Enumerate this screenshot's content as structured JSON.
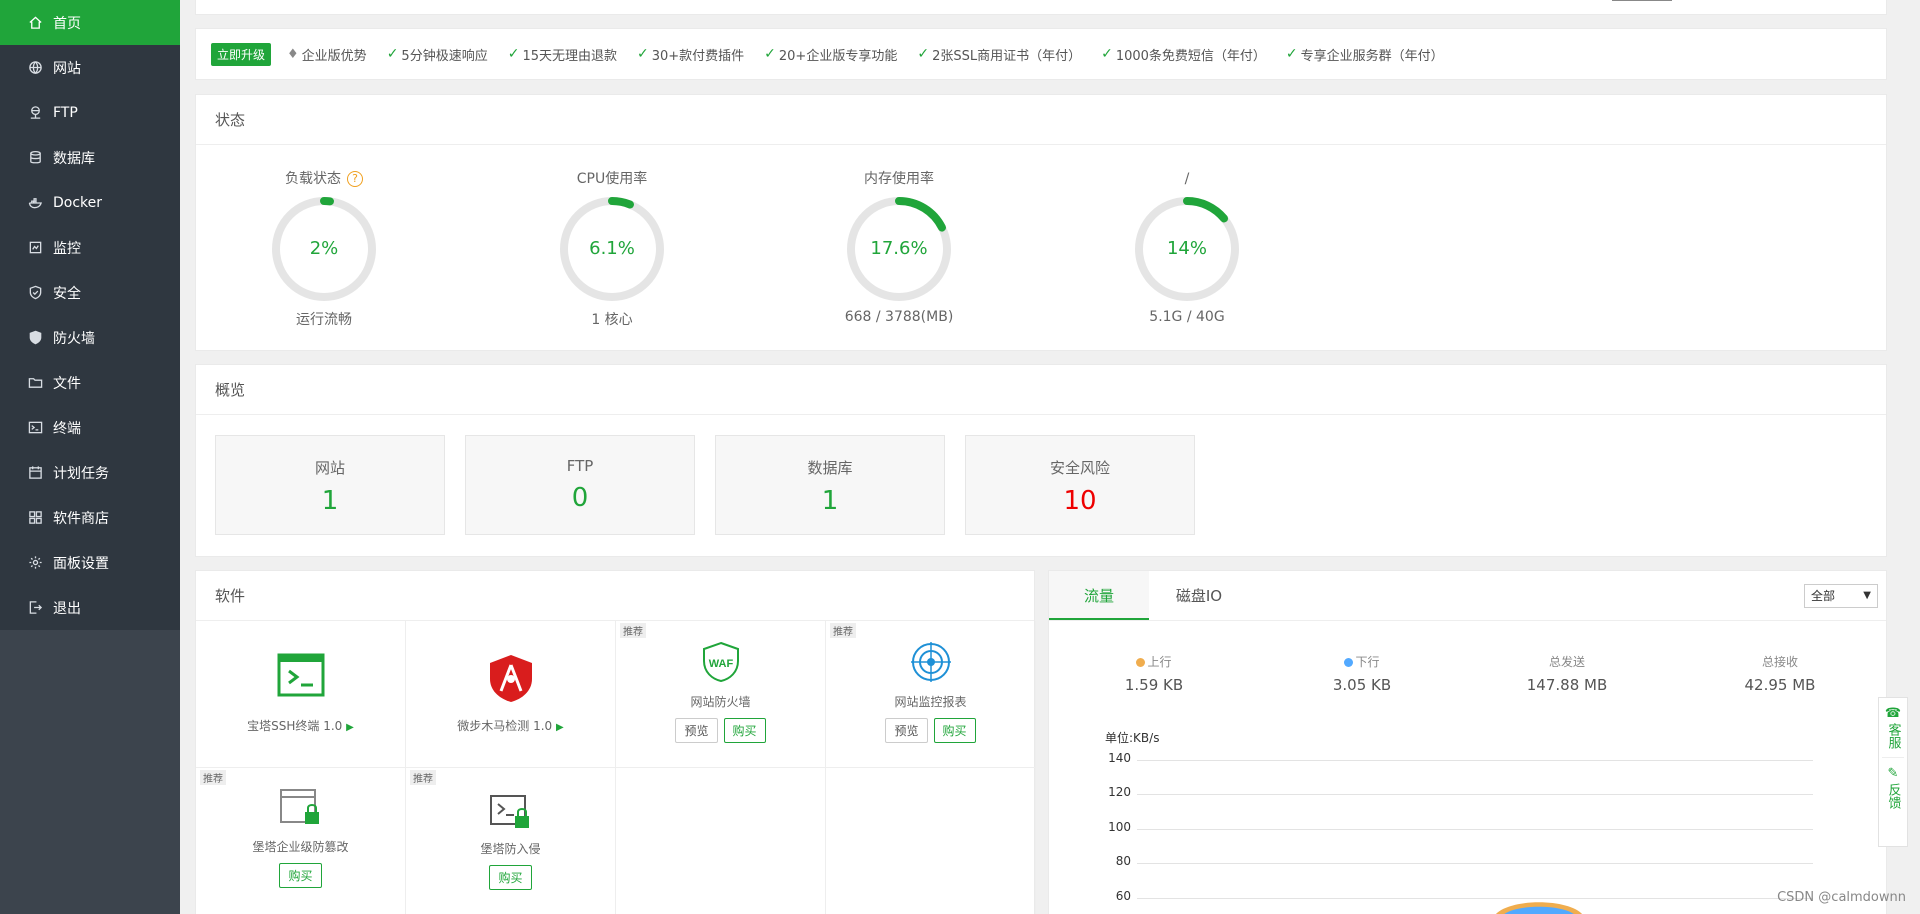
{
  "sidebar": {
    "items": [
      {
        "label": "首页",
        "icon": "home-icon",
        "active": true
      },
      {
        "label": "网站",
        "icon": "globe-icon"
      },
      {
        "label": "FTP",
        "icon": "ftp-icon"
      },
      {
        "label": "数据库",
        "icon": "database-icon"
      },
      {
        "label": "Docker",
        "icon": "docker-icon"
      },
      {
        "label": "监控",
        "icon": "monitor-icon"
      },
      {
        "label": "安全",
        "icon": "shield-icon"
      },
      {
        "label": "防火墙",
        "icon": "firewall-icon"
      },
      {
        "label": "文件",
        "icon": "folder-icon"
      },
      {
        "label": "终端",
        "icon": "terminal-icon"
      },
      {
        "label": "计划任务",
        "icon": "calendar-icon"
      },
      {
        "label": "软件商店",
        "icon": "grid-icon"
      },
      {
        "label": "面板设置",
        "icon": "gear-icon"
      },
      {
        "label": "退出",
        "icon": "logout-icon"
      }
    ]
  },
  "promo": {
    "upgrade": "立即升级",
    "title": "企业版优势",
    "items": [
      "5分钟极速响应",
      "15天无理由退款",
      "30+款付费插件",
      "20+企业版专享功能",
      "2张SSL商用证书（年付）",
      "1000条免费短信（年付）",
      "专享企业服务群（年付）"
    ]
  },
  "status": {
    "title": "状态",
    "gauges": [
      {
        "label": "负载状态",
        "value": "2%",
        "fraction": 0.02,
        "sub": "运行流畅",
        "help": "?"
      },
      {
        "label": "CPU使用率",
        "value": "6.1%",
        "fraction": 0.061,
        "sub": "1 核心"
      },
      {
        "label": "内存使用率",
        "value": "17.6%",
        "fraction": 0.176,
        "sub": "668 / 3788(MB)"
      },
      {
        "label": "/",
        "value": "14%",
        "fraction": 0.14,
        "sub": "5.1G / 40G"
      }
    ]
  },
  "overview": {
    "title": "概览",
    "boxes": [
      {
        "label": "网站",
        "value": "1"
      },
      {
        "label": "FTP",
        "value": "0"
      },
      {
        "label": "数据库",
        "value": "1"
      },
      {
        "label": "安全风险",
        "value": "10"
      }
    ]
  },
  "software": {
    "title": "软件",
    "tag": "推荐",
    "preview": "预览",
    "buy": "购买",
    "items": [
      {
        "name": "宝塔SSH终端 1.0",
        "icon": "terminal-window-icon"
      },
      {
        "name": "微步木马检测 1.0",
        "icon": "antivirus-shield-icon"
      },
      {
        "name": "网站防火墙",
        "icon": "waf-shield-icon"
      },
      {
        "name": "网站监控报表",
        "icon": "radar-icon"
      },
      {
        "name": "堡塔企业级防篡改",
        "icon": "locked-window-icon"
      },
      {
        "name": "堡塔防入侵",
        "icon": "locked-terminal-icon"
      }
    ]
  },
  "traffic": {
    "tabs": [
      "流量",
      "磁盘IO"
    ],
    "select": "全部",
    "stats": [
      {
        "label": "上行",
        "value": "1.59 KB",
        "color": "#f0ad4e"
      },
      {
        "label": "下行",
        "value": "3.05 KB",
        "color": "#52a9ff"
      },
      {
        "label": "总发送",
        "value": "147.88 MB"
      },
      {
        "label": "总接收",
        "value": "42.95 MB"
      }
    ],
    "unit": "单位:KB/s",
    "yticks": [
      "140",
      "120",
      "100",
      "80",
      "60"
    ]
  },
  "float": {
    "service": "客服",
    "feedback": "反馈"
  },
  "watermark": "CSDN @calmdownn"
}
